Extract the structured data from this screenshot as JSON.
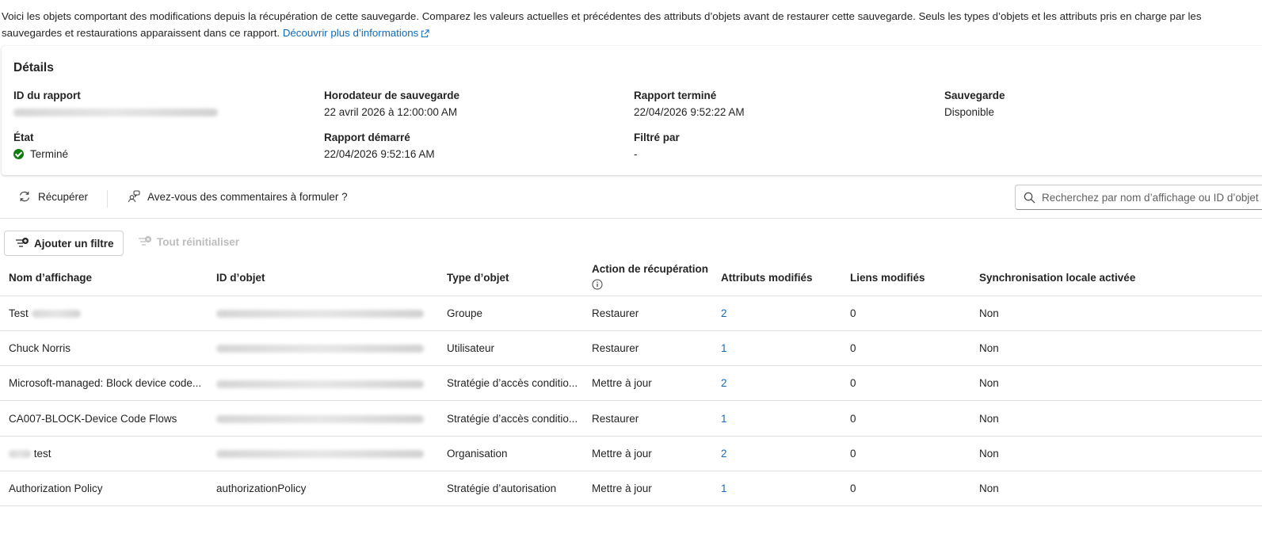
{
  "intro": {
    "text": "Voici les objets comportant des modifications depuis la récupération de cette sauvegarde. Comparez les valeurs actuelles et précédentes des attributs d’objets avant de restaurer cette sauvegarde. Seuls les types d’objets et les attributs pris en charge par les sauvegardes et restaurations apparaissent dans ce rapport.",
    "link": "Découvrir plus d’informations"
  },
  "details": {
    "title": "Détails",
    "report_id_label": "ID du rapport",
    "backup_timestamp_label": "Horodateur de sauvegarde",
    "backup_timestamp_value": "22 avril 2026 à 12:00:00 AM",
    "report_finished_label": "Rapport terminé",
    "report_finished_value": "22/04/2026 9:52:22 AM",
    "backup_label": "Sauvegarde",
    "backup_value": "Disponible",
    "state_label": "État",
    "state_value": "Terminé",
    "report_started_label": "Rapport démarré",
    "report_started_value": "22/04/2026 9:52:16 AM",
    "filtered_by_label": "Filtré par",
    "filtered_by_value": "-"
  },
  "toolbar": {
    "recover_label": "Récupérer",
    "feedback_label": "Avez-vous des commentaires à formuler ?",
    "search_placeholder": "Recherchez par nom d’affichage ou ID d’objet"
  },
  "filters": {
    "add_label": "Ajouter un filtre",
    "reset_label": "Tout réinitialiser"
  },
  "table": {
    "headers": {
      "display_name": "Nom d’affichage",
      "object_id": "ID d’objet",
      "object_type": "Type d’objet",
      "recovery_action": "Action de récupération",
      "modified_attributes": "Attributs modifiés",
      "modified_links": "Liens modifiés",
      "local_sync": "Synchronisation locale activée"
    },
    "rows": [
      {
        "name": "Test",
        "object_id": "",
        "type": "Groupe",
        "action": "Restaurer",
        "attrs": "2",
        "links": "0",
        "sync": "Non"
      },
      {
        "name": "Chuck Norris",
        "object_id": "",
        "type": "Utilisateur",
        "action": "Restaurer",
        "attrs": "1",
        "links": "0",
        "sync": "Non"
      },
      {
        "name": "Microsoft-managed: Block device code...",
        "object_id": "",
        "type": "Stratégie d’accès conditio...",
        "action": "Mettre à jour",
        "attrs": "2",
        "links": "0",
        "sync": "Non"
      },
      {
        "name": "CA007-BLOCK-Device Code Flows",
        "object_id": "",
        "type": "Stratégie d’accès conditio...",
        "action": "Restaurer",
        "attrs": "1",
        "links": "0",
        "sync": "Non"
      },
      {
        "name": "test",
        "object_id": "",
        "type": "Organisation",
        "action": "Mettre à jour",
        "attrs": "2",
        "links": "0",
        "sync": "Non"
      },
      {
        "name": "Authorization Policy",
        "object_id": "authorizationPolicy",
        "type": "Stratégie d’autorisation",
        "action": "Mettre à jour",
        "attrs": "1",
        "links": "0",
        "sync": "Non"
      }
    ]
  }
}
